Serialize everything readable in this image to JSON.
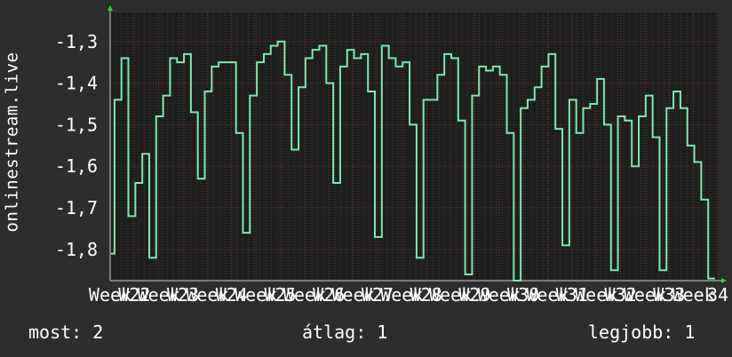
{
  "colors": {
    "background": "#2d2d2d",
    "plot_background": "#1e1e1e",
    "line": "#7de8ae",
    "grid_major": "#7a2a2a",
    "grid_minor": "#3a3a3a",
    "axis_arrow": "#2fd12f",
    "text": "#ffffff"
  },
  "footer": {
    "now": "most: 2",
    "average": "átlag: 1",
    "best": "legjobb: 1"
  },
  "chart_data": {
    "type": "line",
    "title": "",
    "ylabel": "onlinestream.live",
    "xlabel": "",
    "ylim": [
      -1.875,
      -1.23
    ],
    "yticks": [
      -1.3,
      -1.4,
      -1.5,
      -1.6,
      -1.7,
      -1.8
    ],
    "ytick_labels": [
      "-1,3",
      "-1,4",
      "-1,5",
      "-1,6",
      "-1,7",
      "-1,8"
    ],
    "x_tick_labels": [
      "Week",
      "W22",
      "Week",
      "W23",
      "Week",
      "W24",
      "Week",
      "W25",
      "Week",
      "W26",
      "Week",
      "W27",
      "Week",
      "W28",
      "Week",
      "W29",
      "Week",
      "W30",
      "Week",
      "W31",
      "Week",
      "W32",
      "Week",
      "W33",
      "Week",
      "34"
    ],
    "grid": true,
    "legend": "none",
    "series": [
      {
        "values": [
          -1.81,
          -1.44,
          -1.44,
          -1.34,
          -1.34,
          -1.72,
          -1.72,
          -1.64,
          -1.64,
          -1.57,
          -1.57,
          -1.82,
          -1.82,
          -1.48,
          -1.48,
          -1.43,
          -1.43,
          -1.34,
          -1.34,
          -1.35,
          -1.35,
          -1.33,
          -1.33,
          -1.47,
          -1.47,
          -1.63,
          -1.63,
          -1.42,
          -1.42,
          -1.36,
          -1.36,
          -1.35,
          -1.35,
          -1.35,
          -1.35,
          -1.35,
          -1.52,
          -1.52,
          -1.76,
          -1.76,
          -1.43,
          -1.43,
          -1.35,
          -1.35,
          -1.33,
          -1.33,
          -1.31,
          -1.31,
          -1.3,
          -1.3,
          -1.38,
          -1.38,
          -1.56,
          -1.56,
          -1.41,
          -1.41,
          -1.34,
          -1.34,
          -1.32,
          -1.32,
          -1.31,
          -1.31,
          -1.4,
          -1.4,
          -1.64,
          -1.64,
          -1.36,
          -1.36,
          -1.32,
          -1.32,
          -1.34,
          -1.34,
          -1.33,
          -1.33,
          -1.42,
          -1.42,
          -1.77,
          -1.77,
          -1.31,
          -1.31,
          -1.34,
          -1.34,
          -1.36,
          -1.36,
          -1.35,
          -1.35,
          -1.5,
          -1.5,
          -1.82,
          -1.82,
          -1.44,
          -1.44,
          -1.44,
          -1.44,
          -1.38,
          -1.38,
          -1.33,
          -1.33,
          -1.34,
          -1.34,
          -1.49,
          -1.49,
          -1.86,
          -1.86,
          -1.43,
          -1.43,
          -1.36,
          -1.36,
          -1.37,
          -1.37,
          -1.36,
          -1.36,
          -1.38,
          -1.38,
          -1.52,
          -1.52,
          -1.88,
          -1.88,
          -1.46,
          -1.46,
          -1.44,
          -1.44,
          -1.41,
          -1.41,
          -1.36,
          -1.36,
          -1.33,
          -1.33,
          -1.51,
          -1.51,
          -1.79,
          -1.79,
          -1.44,
          -1.44,
          -1.52,
          -1.52,
          -1.46,
          -1.46,
          -1.45,
          -1.45,
          -1.39,
          -1.39,
          -1.5,
          -1.5,
          -1.85,
          -1.85,
          -1.48,
          -1.48,
          -1.49,
          -1.49,
          -1.6,
          -1.6,
          -1.48,
          -1.48,
          -1.43,
          -1.43,
          -1.53,
          -1.53,
          -1.85,
          -1.85,
          -1.46,
          -1.46,
          -1.42,
          -1.42,
          -1.46,
          -1.46,
          -1.55,
          -1.55,
          -1.59,
          -1.59,
          -1.68,
          -1.68,
          -1.87,
          -1.87
        ]
      }
    ]
  }
}
